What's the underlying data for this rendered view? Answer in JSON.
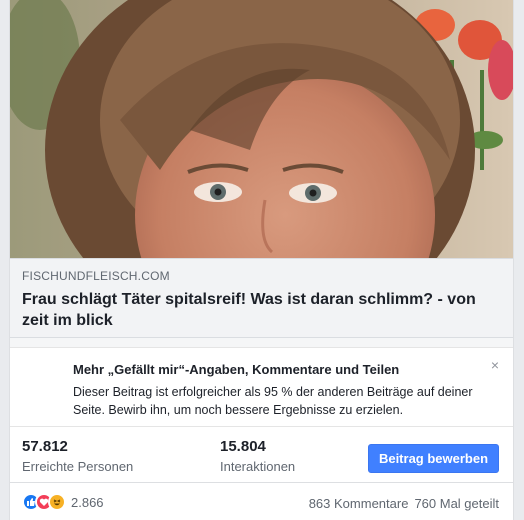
{
  "link_preview": {
    "domain": "FISCHUNDFLEISCH.COM",
    "title": "Frau schlägt Täter spitalsreif! Was ist daran schlimm? - von zeit im blick"
  },
  "notice": {
    "title": "Mehr „Gefällt mir“-Angaben, Kommentare und Teilen",
    "body": "Dieser Beitrag ist erfolgreicher als 95 % der anderen Beiträge auf deiner Seite. Bewirb ihn, um noch bessere Ergebnisse zu erzielen.",
    "close_label": "×"
  },
  "stats": {
    "reach_value": "57.812",
    "reach_label": "Erreichte Personen",
    "engagement_value": "15.804",
    "engagement_label": "Interaktionen",
    "boost_label": "Beitrag bewerben"
  },
  "footer": {
    "reaction_icons": [
      "like-icon",
      "love-icon",
      "haha-icon"
    ],
    "reaction_count": "2.866",
    "comments": "863 Kommentare",
    "shares": "760 Mal geteilt"
  },
  "colors": {
    "accent": "#4080ff",
    "like": "#1877f2",
    "love": "#f33e58",
    "haha": "#f7b125"
  }
}
